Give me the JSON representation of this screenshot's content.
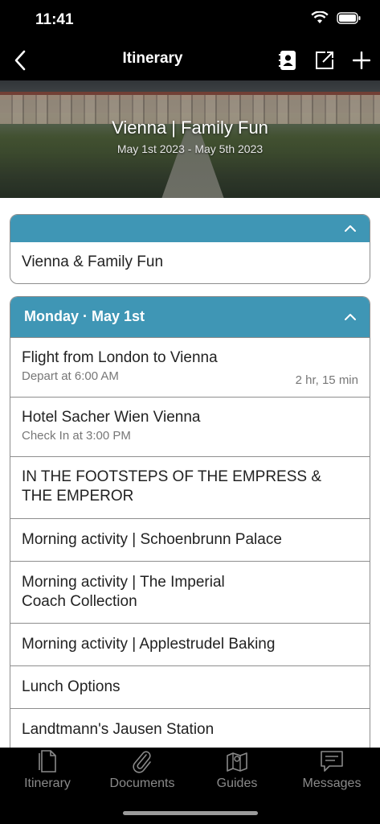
{
  "status_bar": {
    "time": "11:41"
  },
  "nav": {
    "title": "Itinerary"
  },
  "hero": {
    "title": "Vienna | Family Fun",
    "dates": "May 1st 2023 - May 5th 2023"
  },
  "summary_card": {
    "text": "Vienna & Family Fun"
  },
  "day": {
    "header": "Monday · May 1st",
    "items": [
      {
        "title": "Flight from London to Vienna",
        "subtitle": "Depart at 6:00 AM",
        "right": "2 hr, 15 min"
      },
      {
        "title": "Hotel Sacher Wien Vienna",
        "subtitle": "Check In at 3:00 PM"
      },
      {
        "title_line1": "IN THE FOOTSTEPS OF THE EMPRESS &",
        "title_line2": "THE EMPEROR"
      },
      {
        "title": "Morning activity | Schoenbrunn Palace"
      },
      {
        "title_line1": "Morning activity | The Imperial",
        "title_line2": "Coach Collection"
      },
      {
        "title": "Morning activity | Applestrudel Baking"
      },
      {
        "title": "Lunch Options"
      },
      {
        "title": "Landtmann's Jausen Station"
      }
    ]
  },
  "tabs": [
    {
      "label": "Itinerary",
      "icon": "document-icon"
    },
    {
      "label": "Documents",
      "icon": "paperclip-icon"
    },
    {
      "label": "Guides",
      "icon": "map-icon"
    },
    {
      "label": "Messages",
      "icon": "chat-icon"
    }
  ],
  "colors": {
    "accent": "#3f96b5",
    "bar_background": "#000000",
    "tab_inactive": "#8a8a8a"
  }
}
